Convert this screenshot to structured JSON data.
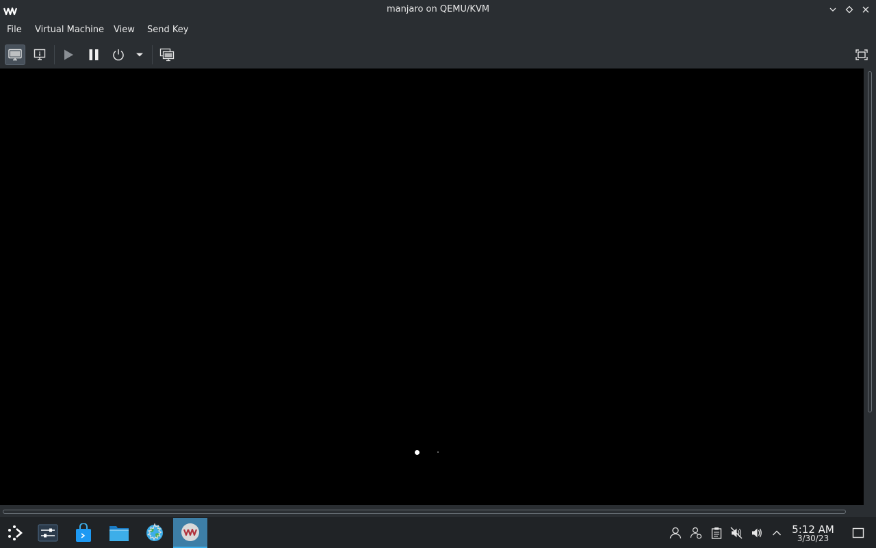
{
  "window": {
    "title": "manjaro on QEMU/KVM",
    "app_icon": "virt-manager-icon",
    "controls": [
      "minimize-icon",
      "maximize-icon",
      "close-icon"
    ]
  },
  "menubar": {
    "items": [
      {
        "label": "File"
      },
      {
        "label": "Virtual Machine"
      },
      {
        "label": "View"
      },
      {
        "label": "Send Key"
      }
    ]
  },
  "toolbar": {
    "buttons": [
      {
        "icon": "console-monitor-icon",
        "active": true
      },
      {
        "icon": "details-info-icon",
        "active": false
      },
      {
        "icon": "play-icon",
        "active": false
      },
      {
        "icon": "pause-icon",
        "active": false
      },
      {
        "icon": "power-icon",
        "active": false
      },
      {
        "icon": "dropdown-arrow-icon",
        "active": false
      },
      {
        "icon": "snapshots-icon",
        "active": false
      },
      {
        "icon": "fullscreen-icon",
        "active": false
      }
    ]
  },
  "taskbar": {
    "launcher": "application-launcher-icon",
    "apps": [
      {
        "icon": "settings-sliders-icon",
        "active": false
      },
      {
        "icon": "discover-store-icon",
        "active": false
      },
      {
        "icon": "file-manager-icon",
        "active": false
      },
      {
        "icon": "web-browser-icon",
        "active": false
      },
      {
        "icon": "virt-manager-icon",
        "active": true
      }
    ],
    "tray": [
      "user-icon",
      "user-switch-icon",
      "clipboard-icon",
      "volume-muted-icon",
      "volume-icon",
      "tray-expand-icon"
    ],
    "clock": {
      "time": "5:12 AM",
      "date": "3/30/23"
    },
    "show_desktop": "show-desktop-icon"
  },
  "colors": {
    "chrome": "#2a2e32",
    "taskbar": "#202326",
    "accent": "#3daee9",
    "viewer_bg": "#000000"
  }
}
